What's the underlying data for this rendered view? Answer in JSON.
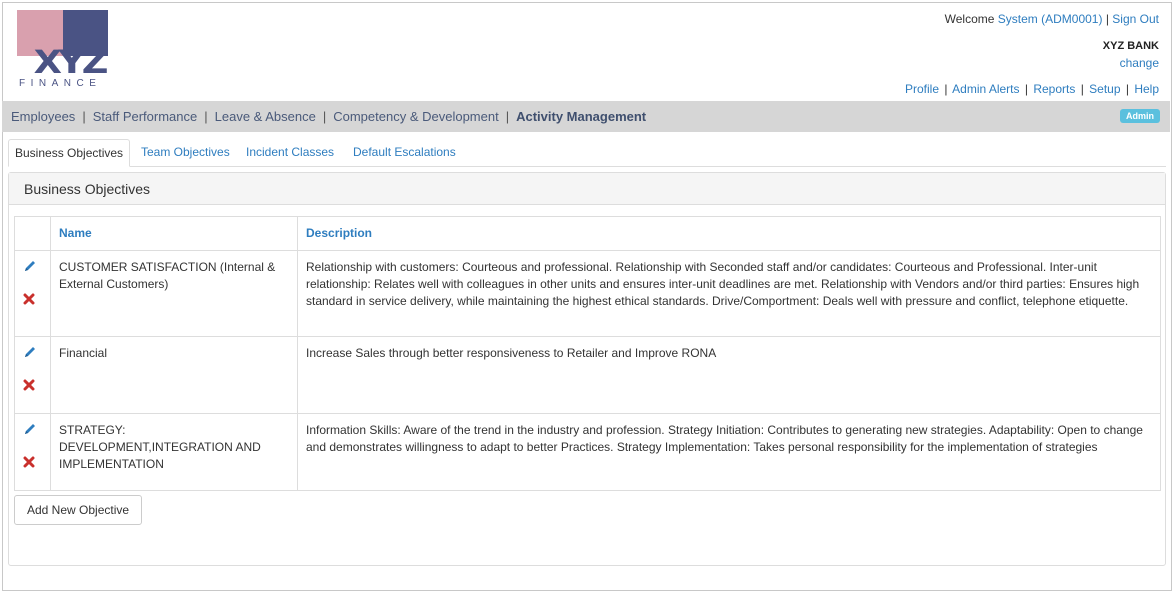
{
  "brand": {
    "logo_letters": "XYZ",
    "logo_sub": "FINANCE",
    "colors": {
      "pink": "#d9a0ae",
      "navy": "#4a5384",
      "link": "#2e7dbf"
    }
  },
  "header": {
    "welcome_prefix": "Welcome",
    "user": "System (ADM0001)",
    "separator": "|",
    "sign_out": "Sign Out",
    "bank": "XYZ BANK",
    "change": "change",
    "links": [
      "Profile",
      "Admin Alerts",
      "Reports",
      "Setup",
      "Help"
    ]
  },
  "nav": {
    "items": [
      "Employees",
      "Staff Performance",
      "Leave & Absence",
      "Competency & Development",
      "Activity Management"
    ],
    "active_index": 4,
    "badge": "Admin"
  },
  "tabs": {
    "items": [
      "Business Objectives",
      "Team Objectives",
      "Incident Classes",
      "Default Escalations"
    ],
    "active_index": 0
  },
  "panel": {
    "title": "Business Objectives",
    "columns": {
      "name": "Name",
      "description": "Description"
    },
    "rows": [
      {
        "name": "CUSTOMER SATISFACTION (Internal & External Customers)",
        "description": "Relationship with customers: Courteous and professional. Relationship with Seconded staff and/or candidates: Courteous and Professional. Inter-unit relationship: Relates well with colleagues in other units and ensures inter-unit deadlines are met. Relationship with Vendors and/or third parties: Ensures high standard in service delivery, while maintaining the highest ethical standards. Drive/Comportment: Deals well with pressure and conflict, telephone etiquette."
      },
      {
        "name": "Financial",
        "description": "Increase Sales through better responsiveness to Retailer and Improve RONA"
      },
      {
        "name": "STRATEGY: DEVELOPMENT,INTEGRATION AND IMPLEMENTATION",
        "description": "Information Skills: Aware of the trend in the industry and profession. Strategy Initiation: Contributes to generating new strategies. Adaptability: Open to change and demonstrates willingness to adapt to better Practices. Strategy Implementation: Takes personal responsibility for the implementation of strategies"
      }
    ],
    "icons": {
      "edit": "pencil-icon",
      "delete": "delete-x-icon"
    },
    "add_button": "Add New Objective"
  }
}
